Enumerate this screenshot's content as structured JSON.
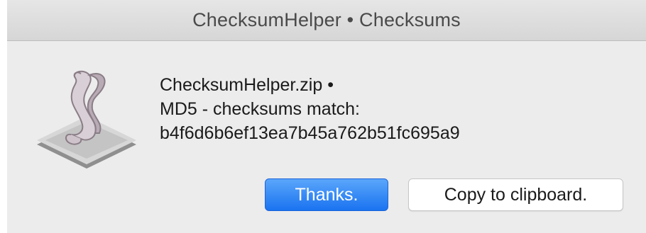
{
  "window": {
    "title": "ChecksumHelper • Checksums"
  },
  "dialog": {
    "icon": "script-scroll-icon",
    "lines": [
      "ChecksumHelper.zip •",
      "MD5 - checksums match:",
      "b4f6d6b6ef13ea7b45a762b51fc695a9"
    ]
  },
  "buttons": {
    "primary_label": "Thanks.",
    "secondary_label": "Copy to clipboard."
  },
  "colors": {
    "accent": "#1a73f0",
    "background": "#ececec",
    "titlebar": "#dcdcdc"
  }
}
